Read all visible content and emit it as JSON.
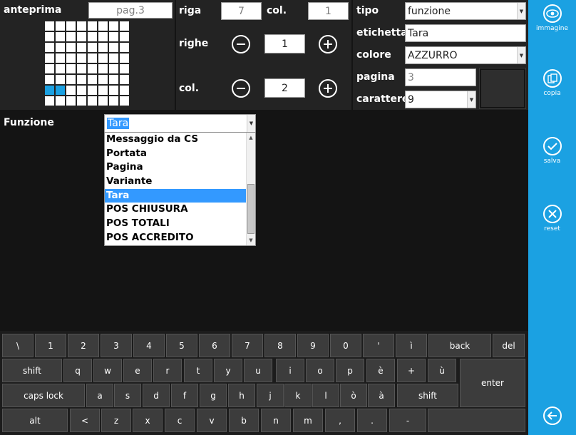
{
  "anteprima": {
    "label": "anteprima",
    "page": "pag.3",
    "grid": {
      "rows": 8,
      "cols": 8,
      "selected": [
        [
          6,
          0
        ],
        [
          6,
          1
        ]
      ]
    }
  },
  "position": {
    "riga_label": "riga",
    "riga_value": "7",
    "col_label": "col.",
    "col_value": "1",
    "righe_label": "righe",
    "righe_value": "1",
    "cols_label": "col.",
    "cols_value": "2"
  },
  "props": {
    "tipo_label": "tipo",
    "tipo_value": "funzione",
    "etichetta_label": "etichetta",
    "etichetta_value": "Tara",
    "colore_label": "colore",
    "colore_value": "AZZURRO",
    "pagina_label": "pagina",
    "pagina_value": "3",
    "carattere_label": "carattere",
    "carattere_value": "9"
  },
  "funzione": {
    "label": "Funzione",
    "selected": "Tara",
    "options": [
      "Messaggio da CS",
      "Portata",
      "Pagina",
      "Variante",
      "Tara",
      "POS CHIUSURA",
      "POS TOTALI",
      "POS ACCREDITO"
    ]
  },
  "keyboard": {
    "row1": [
      "\\",
      "1",
      "2",
      "3",
      "4",
      "5",
      "6",
      "7",
      "8",
      "9",
      "0",
      "'",
      "ì",
      "back",
      "del"
    ],
    "row2": [
      "shift",
      "q",
      "w",
      "e",
      "r",
      "t",
      "y",
      "u",
      "i",
      "o",
      "p",
      "è",
      "+",
      "ù",
      "enter"
    ],
    "row3": [
      "caps lock",
      "a",
      "s",
      "d",
      "f",
      "g",
      "h",
      "j",
      "k",
      "l",
      "ò",
      "à",
      "shift"
    ],
    "row4": [
      "alt",
      "<",
      "z",
      "x",
      "c",
      "v",
      "b",
      "n",
      "m",
      ",",
      ".",
      "-",
      ""
    ]
  },
  "sidebar": {
    "immagine": "immagine",
    "copia": "copia",
    "salva": "salva",
    "reset": "reset"
  },
  "colors": {
    "accent": "#1ba1e2",
    "selection": "#3399ff",
    "background": "#141414",
    "panel": "#232323"
  }
}
